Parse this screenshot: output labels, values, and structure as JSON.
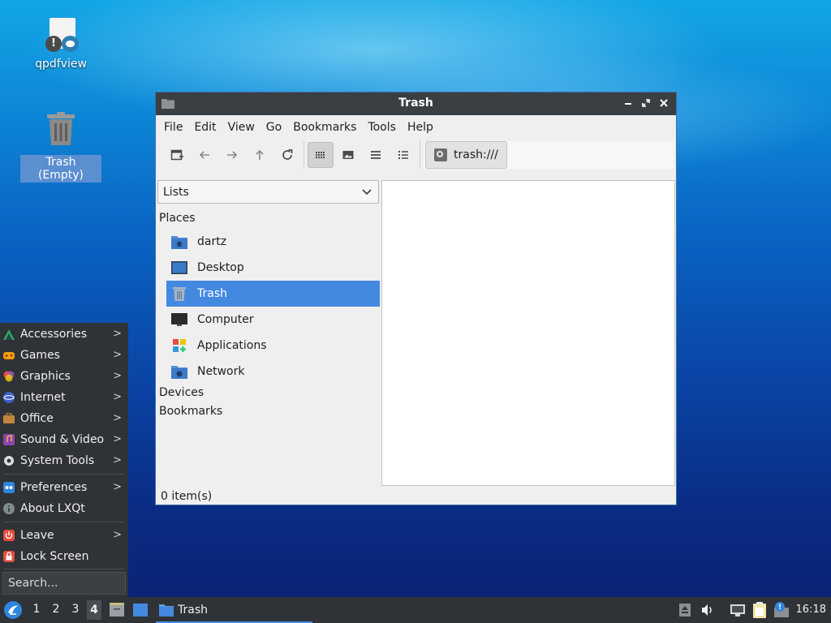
{
  "desktop": {
    "icons": [
      {
        "label": "qpdfview"
      },
      {
        "label": "Trash (Empty)"
      }
    ]
  },
  "window": {
    "title": "Trash",
    "menu": [
      "File",
      "Edit",
      "View",
      "Go",
      "Bookmarks",
      "Tools",
      "Help"
    ],
    "toolbar": {
      "buttons": [
        "new-tab-icon",
        "back-arrow-icon",
        "forward-arrow-icon",
        "up-arrow-icon",
        "refresh-icon",
        "icon-view-icon",
        "thumbnail-view-icon",
        "compact-view-icon",
        "detailed-list-icon"
      ],
      "active_view": "icon-view-icon"
    },
    "path": "trash:///",
    "sidebar": {
      "mode": "Lists",
      "sections": [
        "Places",
        "Devices",
        "Bookmarks"
      ],
      "places": [
        {
          "label": "dartz",
          "icon": "home-folder-icon"
        },
        {
          "label": "Desktop",
          "icon": "desktop-icon"
        },
        {
          "label": "Trash",
          "icon": "trash-icon",
          "selected": true
        },
        {
          "label": "Computer",
          "icon": "computer-icon"
        },
        {
          "label": "Applications",
          "icon": "applications-icon"
        },
        {
          "label": "Network",
          "icon": "network-folder-icon"
        }
      ]
    },
    "status": "0 item(s)"
  },
  "start_menu": {
    "items": [
      {
        "label": "Accessories",
        "submenu": true,
        "icon": "accessories-icon"
      },
      {
        "label": "Games",
        "submenu": true,
        "icon": "games-icon"
      },
      {
        "label": "Graphics",
        "submenu": true,
        "icon": "graphics-icon"
      },
      {
        "label": "Internet",
        "submenu": true,
        "icon": "internet-icon"
      },
      {
        "label": "Office",
        "submenu": true,
        "icon": "office-icon"
      },
      {
        "label": "Sound & Video",
        "submenu": true,
        "icon": "sound-video-icon"
      },
      {
        "label": "System Tools",
        "submenu": true,
        "icon": "system-tools-icon"
      },
      {
        "label": "Preferences",
        "submenu": true,
        "icon": "preferences-icon"
      },
      {
        "label": "About LXQt",
        "submenu": false,
        "icon": "about-icon"
      },
      {
        "label": "Leave",
        "submenu": true,
        "icon": "leave-icon"
      },
      {
        "label": "Lock Screen",
        "submenu": false,
        "icon": "lock-icon"
      }
    ],
    "submenu_arrow": ">",
    "search_placeholder": "Search..."
  },
  "taskbar": {
    "desktops": [
      "1",
      "2",
      "3",
      "4"
    ],
    "active_desktop": "4",
    "task": "Trash",
    "clock": "16:18"
  },
  "colors": {
    "selection": "#4389e0",
    "panel": "#2f3236",
    "titlebar": "#3a3f44"
  }
}
